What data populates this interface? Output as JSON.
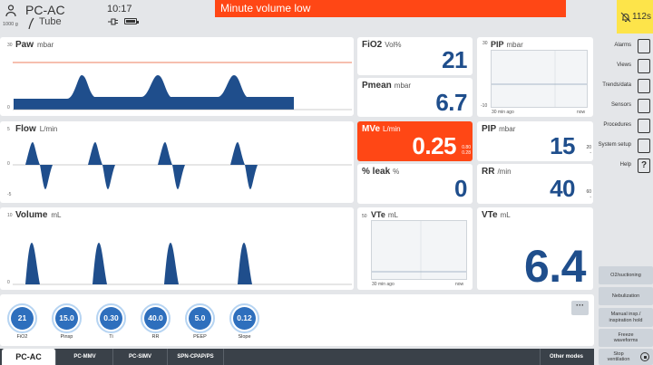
{
  "header": {
    "mode": "PC-AC",
    "patient_weight": "1000 g",
    "tube": "Tube",
    "time": "10:17",
    "alarm": "Minute volume low",
    "silence_timer": "112s",
    "icons": [
      "baby-icon",
      "tube-icon",
      "plug-icon",
      "battery-icon",
      "bell-off-icon"
    ]
  },
  "waveforms": {
    "paw": {
      "title": "Paw",
      "unit": "mbar",
      "ticks": [
        "30",
        "0"
      ]
    },
    "flow": {
      "title": "Flow",
      "unit": "L/min",
      "ticks": [
        "5",
        "0",
        "-5"
      ]
    },
    "volume": {
      "title": "Volume",
      "unit": "mL",
      "ticks": [
        "10",
        "0"
      ]
    }
  },
  "numerics": {
    "fio2": {
      "label": "FiO2",
      "unit": "Vol%",
      "value": "21"
    },
    "pmean": {
      "label": "Pmean",
      "unit": "mbar",
      "value": "6.7"
    },
    "mve": {
      "label": "MVe",
      "unit": "L/min",
      "value": "0.25",
      "limit_high": "0.80",
      "limit_low": "0.28"
    },
    "leak": {
      "label": "% leak",
      "unit": "%",
      "value": "0"
    },
    "pip": {
      "label": "PIP",
      "unit": "mbar",
      "value": "15",
      "limit_high": "20",
      "limit_low": "-"
    },
    "rr": {
      "label": "RR",
      "unit": "/min",
      "value": "40",
      "limit_high": "60",
      "limit_low": "-"
    },
    "vte": {
      "label": "VTe",
      "unit": "mL",
      "value": "6.4"
    }
  },
  "trends": {
    "pip": {
      "title": "PIP",
      "unit": "mbar",
      "y_top": "30",
      "y_bottom": "-10",
      "x_left": "30 min ago",
      "x_right": "now"
    },
    "vte": {
      "title": "VTe",
      "unit": "mL",
      "y_top": "50",
      "x_left": "30 min ago",
      "x_right": "now"
    }
  },
  "sidebar": {
    "items": [
      {
        "label": "Alarms",
        "icon": "alarm-settings-icon"
      },
      {
        "label": "Views",
        "icon": "views-icon"
      },
      {
        "label": "Trends/data",
        "icon": "trends-icon"
      },
      {
        "label": "Sensors",
        "icon": "sensors-icon"
      },
      {
        "label": "Procedures",
        "icon": "procedures-icon"
      },
      {
        "label": "System setup",
        "icon": "system-setup-icon"
      },
      {
        "label": "Help",
        "icon": "help-icon"
      }
    ],
    "actions": {
      "o2": "O2/suctioning",
      "nebulization": "Nebulization",
      "manual_1": "Manual insp./",
      "manual_2": "inspiration hold",
      "freeze_1": "Freeze",
      "freeze_2": "waveforms",
      "stop_1": "Stop",
      "stop_2": "ventilation"
    }
  },
  "settings": {
    "knobs": [
      {
        "name": "FiO2",
        "value": "21"
      },
      {
        "name": "Pinsp",
        "value": "15.0"
      },
      {
        "name": "Ti",
        "value": "0.30"
      },
      {
        "name": "RR",
        "value": "40.0"
      },
      {
        "name": "PEEP",
        "value": "5.0"
      },
      {
        "name": "Slope",
        "value": "0.12"
      }
    ],
    "more": "···"
  },
  "modes": {
    "tabs": [
      "PC-AC",
      "PC-MMV",
      "PC-SIMV",
      "SPN-CPAP/PS"
    ],
    "other": "Other modes"
  },
  "colors": {
    "alarm": "#ff4715",
    "value": "#1f4e8c",
    "knob": "#2e6fbd",
    "silence": "#fde44a"
  }
}
